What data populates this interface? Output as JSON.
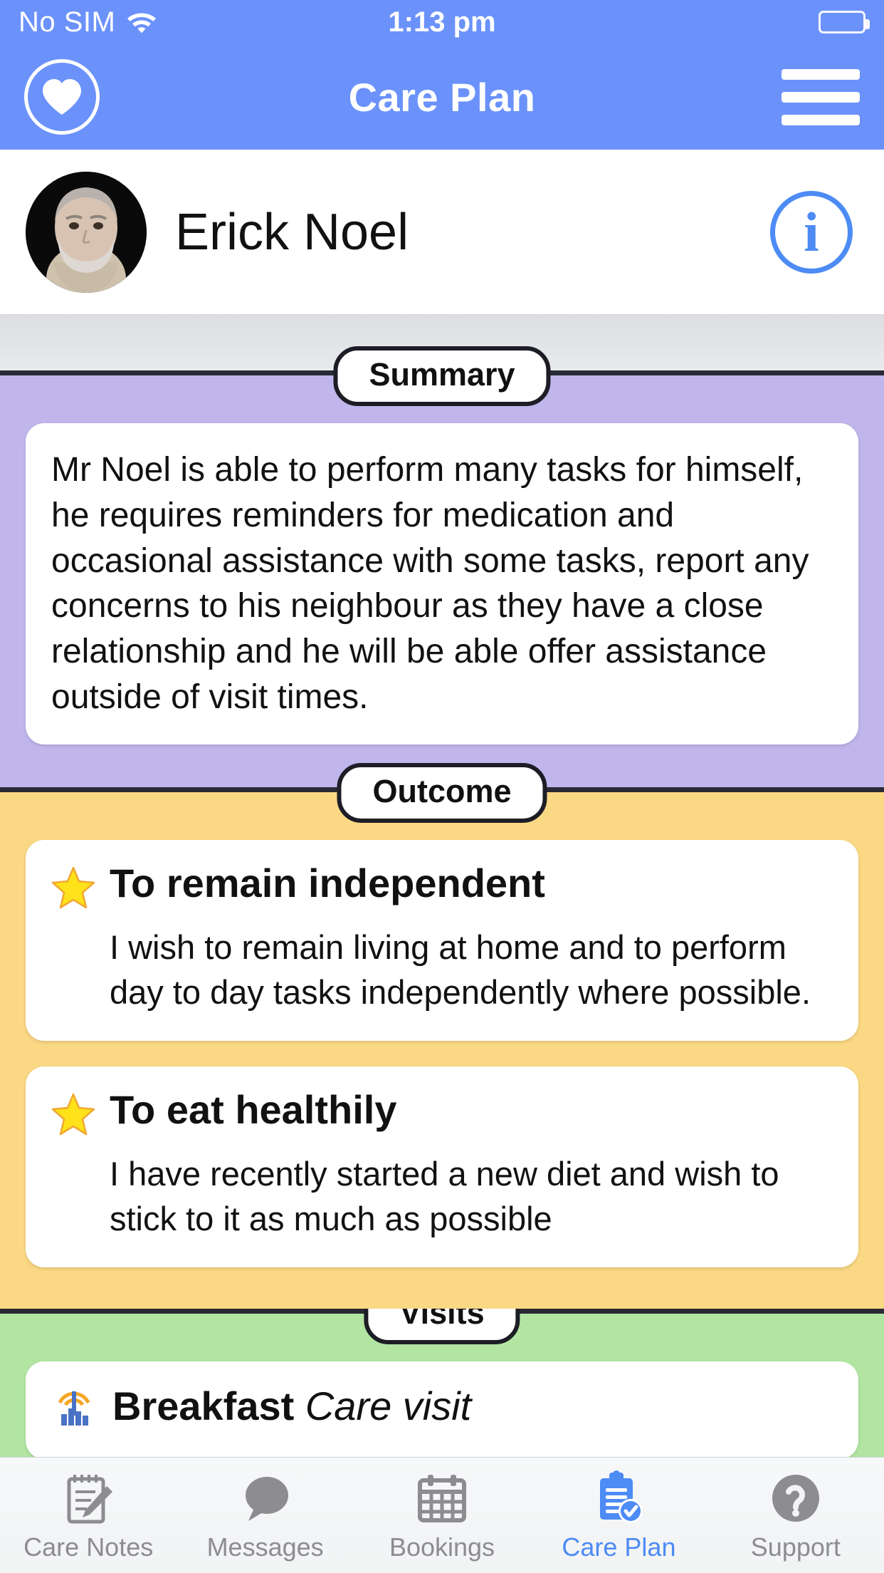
{
  "statusbar": {
    "carrier": "No SIM",
    "time": "1:13 pm",
    "wifi_icon": "wifi-icon",
    "battery_icon": "battery-icon"
  },
  "navbar": {
    "title": "Care Plan",
    "logo_icon": "heart-circle-icon",
    "menu_icon": "hamburger-menu-icon",
    "accent_color": "#6b92fb"
  },
  "profile": {
    "name": "Erick Noel",
    "avatar_icon": "avatar-photo",
    "info_icon": "info-circle-icon",
    "info_glyph": "i"
  },
  "sections": [
    {
      "label": "Summary",
      "background_color": "#c0b6ec",
      "text": "Mr Noel is able to perform many tasks for himself, he requires reminders for medication and occasional assistance with some tasks, report any concerns to his neighbour as they have a close relationship and he will be able offer assistance outside of visit times."
    },
    {
      "label": "Outcome",
      "background_color": "#fad884",
      "items": [
        {
          "icon": "star-icon",
          "title": "To remain independent",
          "description": "I wish to remain living at home and to perform day to day tasks independently where possible."
        },
        {
          "icon": "star-icon",
          "title": "To eat healthily",
          "description": "I have recently started a new diet and wish to stick to it as much as possible"
        }
      ]
    },
    {
      "label": "Visits",
      "background_color": "#b2e5a2",
      "items": [
        {
          "icon": "sunrise-icon",
          "title_bold": "Breakfast",
          "title_italic": "Care visit"
        }
      ]
    }
  ],
  "tabbar": {
    "active_color": "#4d8bf5",
    "inactive_color": "#8c8c91",
    "tabs": [
      {
        "label": "Care Notes",
        "icon": "notepad-pencil-icon",
        "active": false
      },
      {
        "label": "Messages",
        "icon": "speech-bubble-icon",
        "active": false
      },
      {
        "label": "Bookings",
        "icon": "calendar-icon",
        "active": false
      },
      {
        "label": "Care Plan",
        "icon": "clipboard-check-icon",
        "active": true
      },
      {
        "label": "Support",
        "icon": "question-circle-icon",
        "active": false
      }
    ]
  }
}
